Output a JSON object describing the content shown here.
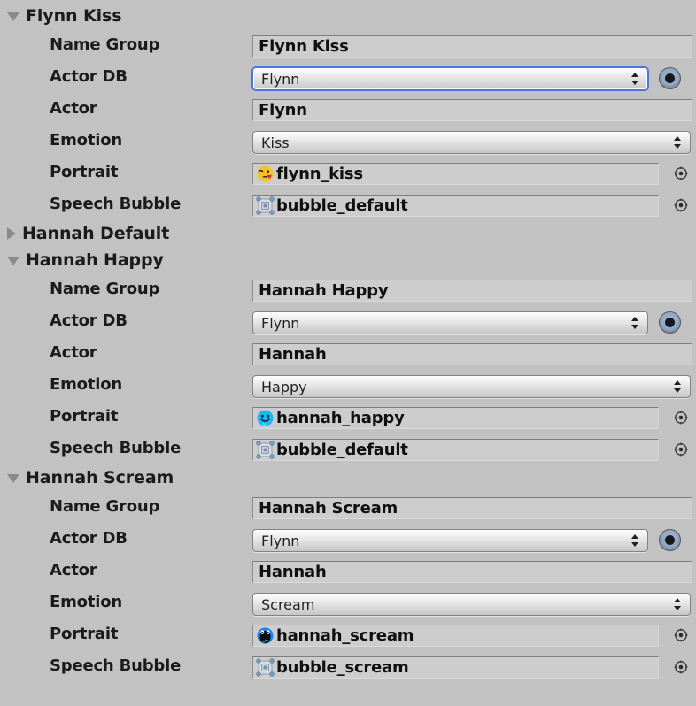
{
  "window": {
    "background_color": "#c2c2c2",
    "accent_focus_color": "#4a77d6"
  },
  "field_labels": {
    "name_group": "Name Group",
    "actor_db": "Actor DB",
    "actor": "Actor",
    "emotion": "Emotion",
    "portrait": "Portrait",
    "speech_bubble": "Speech Bubble"
  },
  "icons": {
    "expanded": "triangle-down-icon",
    "collapsed": "triangle-right-icon",
    "popup_arrows": "up-down-arrow-icon",
    "object_picker": "target-circle-icon",
    "radio": "radio-selected-icon"
  },
  "groups": [
    {
      "title": "Flynn Kiss",
      "expanded": true,
      "fields": {
        "name_group": "Flynn Kiss",
        "actor_db": "Flynn",
        "actor_db_focused": true,
        "actor": "Flynn",
        "emotion": "Kiss",
        "portrait": "flynn_kiss",
        "portrait_icon": "kissing-face-emoji",
        "speech_bubble": "bubble_default",
        "speech_bubble_icon": "sprite-asset-icon"
      }
    },
    {
      "title": "Hannah Default",
      "expanded": false,
      "fields": null
    },
    {
      "title": "Hannah Happy",
      "expanded": true,
      "fields": {
        "name_group": "Hannah Happy",
        "actor_db": "Flynn",
        "actor_db_focused": false,
        "actor": "Hannah",
        "emotion": "Happy",
        "portrait": "hannah_happy",
        "portrait_icon": "happy-face-cyan-emoji",
        "speech_bubble": "bubble_default",
        "speech_bubble_icon": "sprite-asset-icon"
      }
    },
    {
      "title": "Hannah Scream",
      "expanded": true,
      "fields": {
        "name_group": "Hannah Scream",
        "actor_db": "Flynn",
        "actor_db_focused": false,
        "actor": "Hannah",
        "emotion": "Scream",
        "portrait": "hannah_scream",
        "portrait_icon": "screaming-face-blue-emoji",
        "speech_bubble": "bubble_scream",
        "speech_bubble_icon": "sprite-asset-icon"
      }
    }
  ]
}
